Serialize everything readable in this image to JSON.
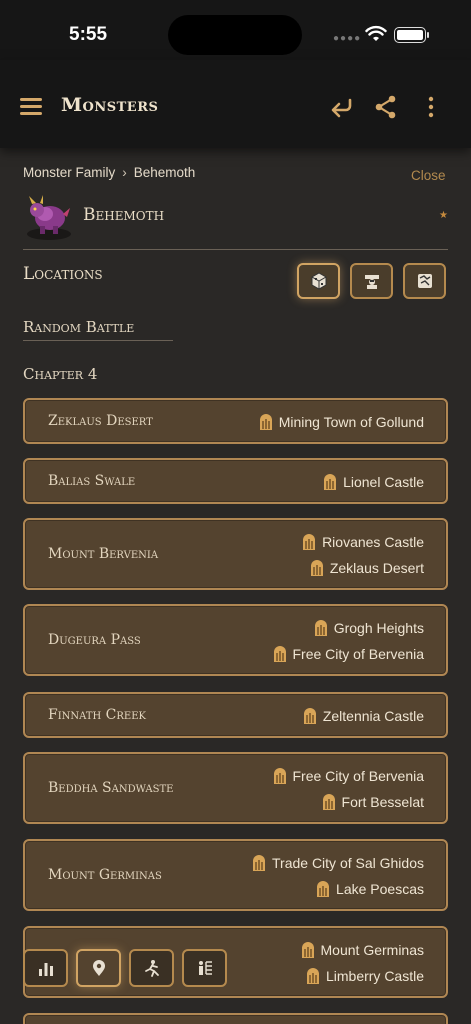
{
  "status_bar": {
    "time": "5:55"
  },
  "header": {
    "title": "Monsters"
  },
  "breadcrumb": {
    "parent": "Monster Family",
    "current": "Behemoth"
  },
  "close_label": "Close",
  "monster": {
    "name": "Behemoth",
    "favorite": "★"
  },
  "locations_section": {
    "title": "Locations"
  },
  "random_battle_title": "Random Battle",
  "chapter_title": "Chapter 4",
  "rows": [
    {
      "name": "Zeklaus Desert",
      "destinations": [
        "Mining Town of Gollund"
      ]
    },
    {
      "name": "Balias Swale",
      "destinations": [
        "Lionel Castle"
      ]
    },
    {
      "name": "Mount Bervenia",
      "destinations": [
        "Riovanes Castle",
        "Zeklaus Desert"
      ]
    },
    {
      "name": "Dugeura Pass",
      "destinations": [
        "Grogh Heights",
        "Free City of Bervenia"
      ]
    },
    {
      "name": "Finnath Creek",
      "destinations": [
        "Zeltennia Castle"
      ]
    },
    {
      "name": "Beddha Sandwaste",
      "destinations": [
        "Free City of Bervenia",
        "Fort Besselat"
      ]
    },
    {
      "name": "Mount Germinas",
      "destinations": [
        "Trade City of Sal Ghidos",
        "Lake Poescas"
      ]
    },
    {
      "name": "",
      "destinations": [
        "Mount Germinas",
        "Limberry Castle"
      ]
    }
  ],
  "icons": {
    "menu": "hamburger-icon",
    "back": "return-arrow-icon",
    "share": "share-icon",
    "more": "more-vertical-icon",
    "loc_buttons": [
      "treasure-chest-icon",
      "merchant-icon",
      "map-icon"
    ],
    "bottom_buttons": [
      "bar-chart-icon",
      "location-pin-icon",
      "running-figure-icon",
      "job-tree-icon"
    ]
  },
  "colors": {
    "accent": "#b58a4e",
    "row_bg": "#54432f",
    "background": "#2a2826"
  }
}
